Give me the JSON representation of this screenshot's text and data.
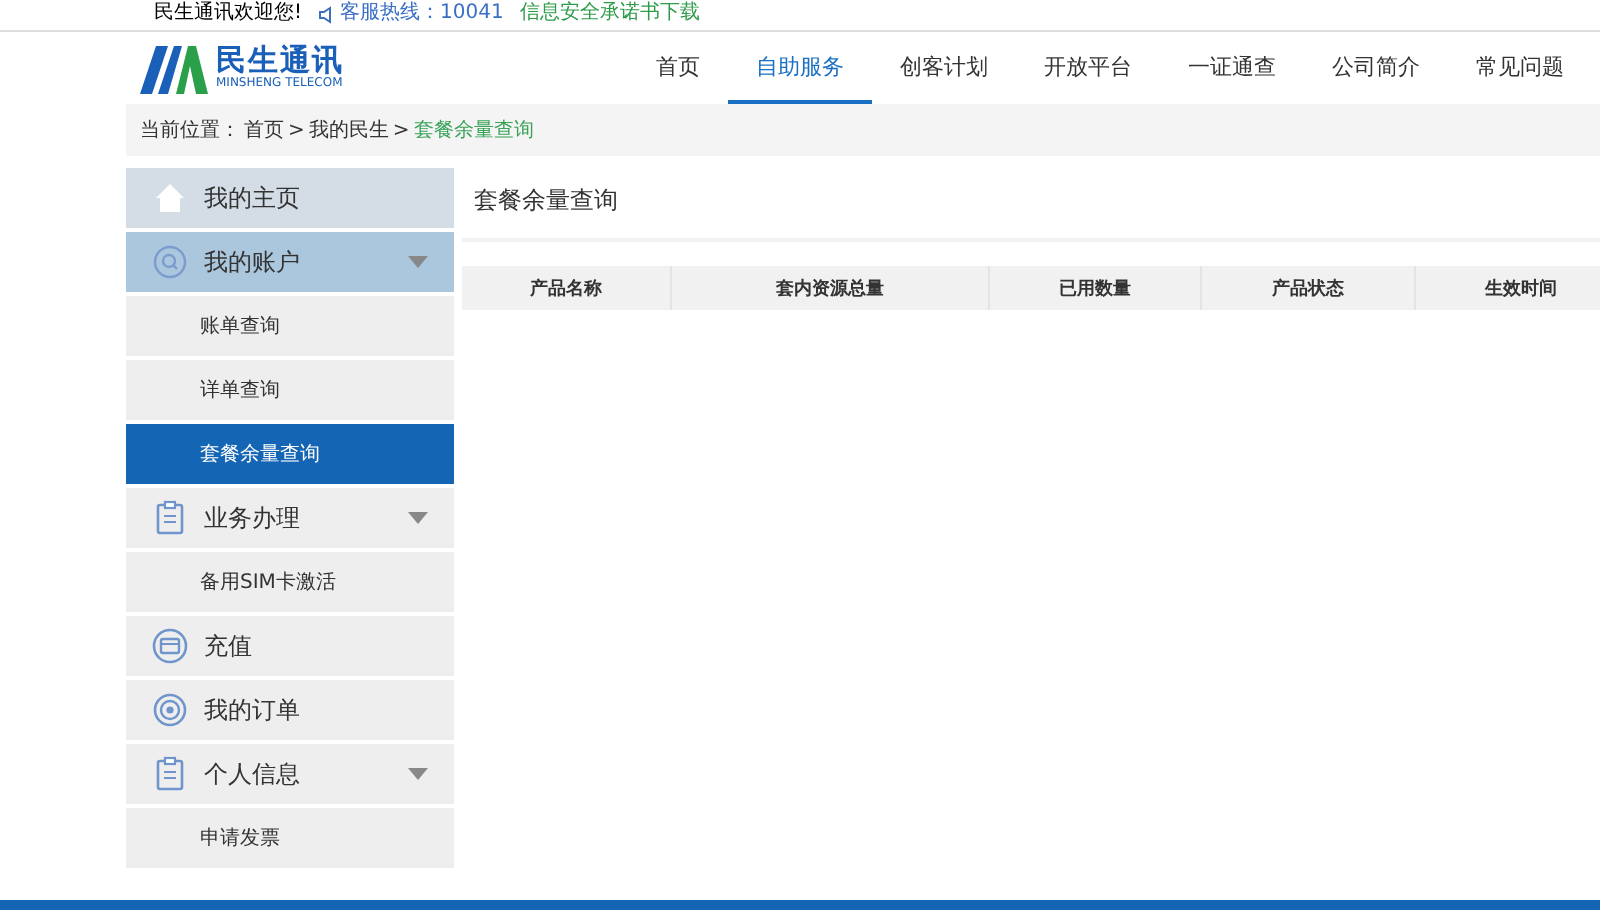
{
  "top_bar": {
    "welcome": "民生通讯欢迎您!",
    "hotline": "客服热线：10041",
    "promise_link": "信息安全承诺书下载"
  },
  "logo": {
    "name": "民生通讯",
    "subtitle": "MINSHENG TELECOM"
  },
  "nav": [
    {
      "label": "首页",
      "selected": false
    },
    {
      "label": "自助服务",
      "selected": true
    },
    {
      "label": "创客计划",
      "selected": false
    },
    {
      "label": "开放平台",
      "selected": false
    },
    {
      "label": "一证通查",
      "selected": false
    },
    {
      "label": "公司简介",
      "selected": false
    },
    {
      "label": "常见问题",
      "selected": false
    }
  ],
  "breadcrumb": {
    "label": "当前位置：",
    "path": [
      "首页",
      "我的民生"
    ],
    "separator": ">",
    "current": "套餐余量查询"
  },
  "sidebar": {
    "items": [
      {
        "kind": "home",
        "label": "我的主页",
        "caret": false,
        "active": false,
        "selected": false
      },
      {
        "kind": "search",
        "label": "我的账户",
        "caret": true,
        "active": true,
        "selected": false
      },
      {
        "kind": "sub",
        "label": "账单查询",
        "caret": false,
        "active": false,
        "selected": false
      },
      {
        "kind": "sub",
        "label": "详单查询",
        "caret": false,
        "active": false,
        "selected": false
      },
      {
        "kind": "sub",
        "label": "套餐余量查询",
        "caret": false,
        "active": false,
        "selected": true
      },
      {
        "kind": "clipboard",
        "label": "业务办理",
        "caret": true,
        "active": false,
        "selected": false
      },
      {
        "kind": "sub",
        "label": "备用SIM卡激活",
        "caret": false,
        "active": false,
        "selected": false
      },
      {
        "kind": "card",
        "label": "充值",
        "caret": false,
        "active": false,
        "selected": false
      },
      {
        "kind": "target",
        "label": "我的订单",
        "caret": false,
        "active": false,
        "selected": false
      },
      {
        "kind": "clipboard",
        "label": "个人信息",
        "caret": true,
        "active": false,
        "selected": false
      },
      {
        "kind": "sub",
        "label": "申请发票",
        "caret": false,
        "active": false,
        "selected": false
      }
    ]
  },
  "content": {
    "title": "套餐余量查询",
    "table": {
      "columns": [
        "产品名称",
        "套内资源总量",
        "已用数量",
        "产品状态",
        "生效时间"
      ]
    }
  }
}
